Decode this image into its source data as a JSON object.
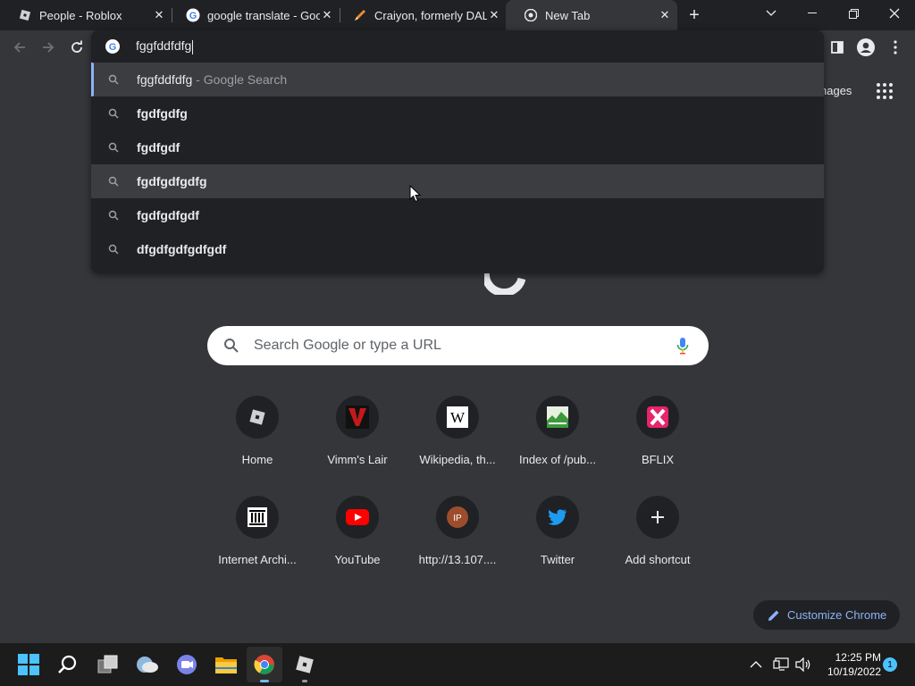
{
  "tabs": [
    {
      "title": "People - Roblox",
      "active": false
    },
    {
      "title": "google translate - Goo",
      "active": false
    },
    {
      "title": "Craiyon, formerly DALL",
      "active": false
    },
    {
      "title": "New Tab",
      "active": true
    }
  ],
  "omnibox": {
    "input_value": "fggfddfdfg",
    "suggestions": [
      {
        "text": "fggfddfdfg",
        "suffix": " - Google Search"
      },
      {
        "text": "fgdfgdfg",
        "suffix": ""
      },
      {
        "text": "fgdfgdf",
        "suffix": ""
      },
      {
        "text": "fgdfgdfgdfg",
        "suffix": ""
      },
      {
        "text": "fgdfgdfgdf",
        "suffix": ""
      },
      {
        "text": "dfgdfgdfgdfgdf",
        "suffix": ""
      }
    ]
  },
  "ntp": {
    "images_link": "nages",
    "search_placeholder": "Search Google or type a URL",
    "shortcuts": [
      {
        "label": "Home",
        "icon": "roblox-icon"
      },
      {
        "label": "Vimm's Lair",
        "icon": "vimms-lair-icon"
      },
      {
        "label": "Wikipedia, th...",
        "icon": "wikipedia-icon"
      },
      {
        "label": "Index of /pub...",
        "icon": "index-icon"
      },
      {
        "label": "BFLIX",
        "icon": "bflix-icon"
      },
      {
        "label": "Internet Archi...",
        "icon": "internet-archive-icon"
      },
      {
        "label": "YouTube",
        "icon": "youtube-icon"
      },
      {
        "label": "http://13.107....",
        "icon": "ip-icon",
        "glyph": "IP"
      },
      {
        "label": "Twitter",
        "icon": "twitter-icon"
      },
      {
        "label": "Add shortcut",
        "icon": "plus-icon"
      }
    ],
    "customize_label": "Customize Chrome"
  },
  "taskbar": {
    "time": "12:25 PM",
    "date": "10/19/2022",
    "notification_count": "1"
  },
  "colors": {
    "accent": "#8ab4f8",
    "background": "#35363a",
    "dropdown": "#202124"
  }
}
